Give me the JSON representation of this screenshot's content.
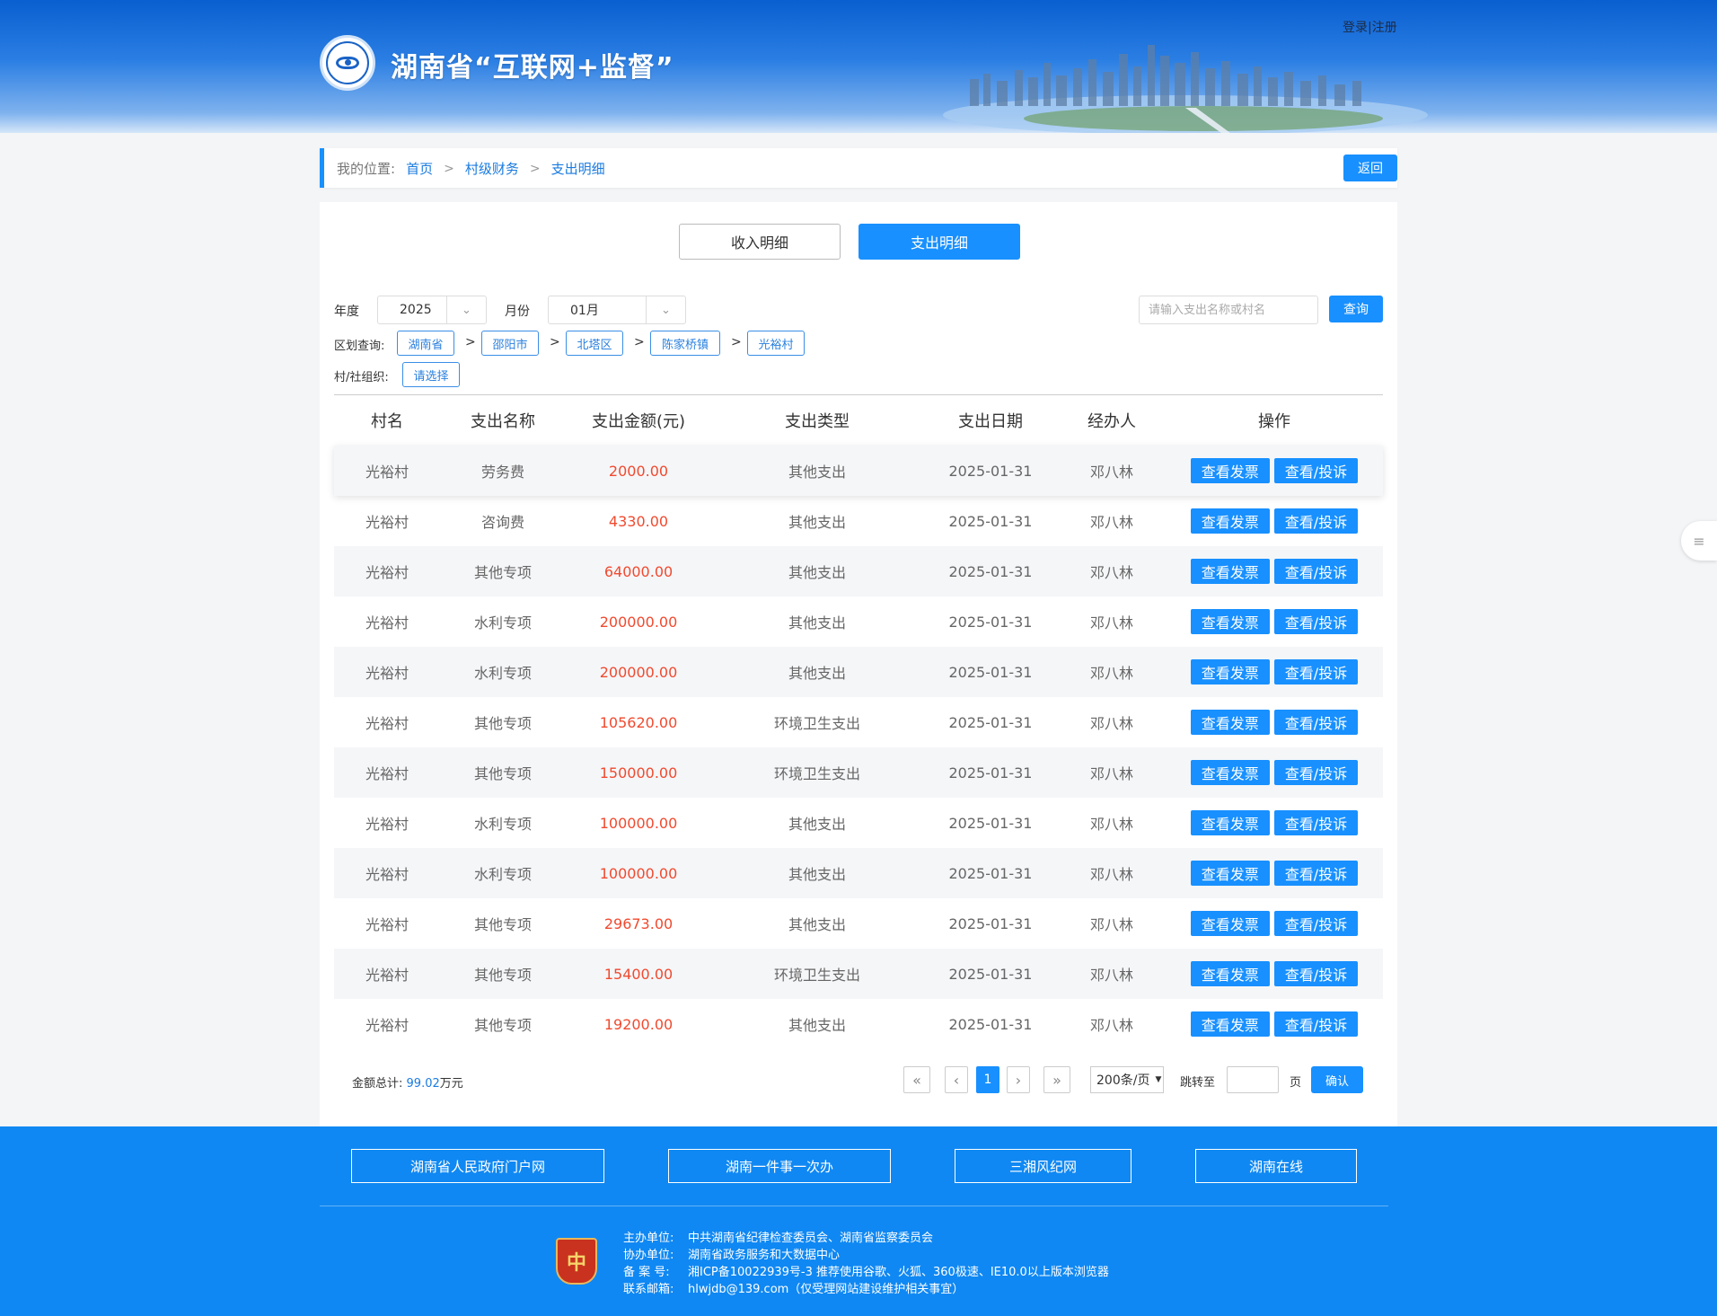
{
  "header": {
    "site_title": "湖南省“互联网+监督”",
    "login": "登录",
    "separator": "|",
    "register": "注册"
  },
  "breadcrumb": {
    "prefix": "我的位置:",
    "items": [
      "首页",
      "村级财务",
      "支出明细"
    ],
    "sep": ">",
    "back_label": "返回"
  },
  "tabs": {
    "income": "收入明细",
    "expense": "支出明细"
  },
  "filters": {
    "year_label": "年度",
    "year_value": "2025",
    "month_label": "月份",
    "month_value": "01月",
    "search_placeholder": "请输入支出名称或村名",
    "query_label": "查询",
    "region_label": "区划查询:",
    "regions": [
      "湖南省",
      "邵阳市",
      "北塔区",
      "陈家桥镇",
      "光裕村"
    ],
    "org_label": "村/社组织:",
    "org_value": "请选择"
  },
  "table": {
    "headers": [
      "村名",
      "支出名称",
      "支出金额(元)",
      "支出类型",
      "支出日期",
      "经办人",
      "操作"
    ],
    "action_invoice": "查看发票",
    "action_complain": "查看/投诉",
    "rows": [
      {
        "village": "光裕村",
        "name": "劳务费",
        "amount": "2000.00",
        "type": "其他支出",
        "date": "2025-01-31",
        "handler": "邓八林"
      },
      {
        "village": "光裕村",
        "name": "咨询费",
        "amount": "4330.00",
        "type": "其他支出",
        "date": "2025-01-31",
        "handler": "邓八林"
      },
      {
        "village": "光裕村",
        "name": "其他专项",
        "amount": "64000.00",
        "type": "其他支出",
        "date": "2025-01-31",
        "handler": "邓八林"
      },
      {
        "village": "光裕村",
        "name": "水利专项",
        "amount": "200000.00",
        "type": "其他支出",
        "date": "2025-01-31",
        "handler": "邓八林"
      },
      {
        "village": "光裕村",
        "name": "水利专项",
        "amount": "200000.00",
        "type": "其他支出",
        "date": "2025-01-31",
        "handler": "邓八林"
      },
      {
        "village": "光裕村",
        "name": "其他专项",
        "amount": "105620.00",
        "type": "环境卫生支出",
        "date": "2025-01-31",
        "handler": "邓八林"
      },
      {
        "village": "光裕村",
        "name": "其他专项",
        "amount": "150000.00",
        "type": "环境卫生支出",
        "date": "2025-01-31",
        "handler": "邓八林"
      },
      {
        "village": "光裕村",
        "name": "水利专项",
        "amount": "100000.00",
        "type": "其他支出",
        "date": "2025-01-31",
        "handler": "邓八林"
      },
      {
        "village": "光裕村",
        "name": "水利专项",
        "amount": "100000.00",
        "type": "其他支出",
        "date": "2025-01-31",
        "handler": "邓八林"
      },
      {
        "village": "光裕村",
        "name": "其他专项",
        "amount": "29673.00",
        "type": "其他支出",
        "date": "2025-01-31",
        "handler": "邓八林"
      },
      {
        "village": "光裕村",
        "name": "其他专项",
        "amount": "15400.00",
        "type": "环境卫生支出",
        "date": "2025-01-31",
        "handler": "邓八林"
      },
      {
        "village": "光裕村",
        "name": "其他专项",
        "amount": "19200.00",
        "type": "其他支出",
        "date": "2025-01-31",
        "handler": "邓八林"
      }
    ]
  },
  "summary": {
    "total_label": "金额总计:",
    "total_value": "99.02",
    "total_unit": "万元"
  },
  "pagination": {
    "first": "«",
    "prev": "‹",
    "current": "1",
    "next": "›",
    "last": "»",
    "page_size": "200条/页",
    "jump_label": "跳转至",
    "page_unit": "页",
    "confirm_label": "确认"
  },
  "footer": {
    "links": [
      "湖南省人民政府门户网",
      "湖南一件事一次办",
      "三湘风纪网",
      "湖南在线"
    ],
    "info": [
      {
        "label": "主办单位:",
        "value": "中共湖南省纪律检查委员会、湖南省监察委员会"
      },
      {
        "label": "协办单位:",
        "value": "湖南省政务服务和大数据中心"
      },
      {
        "label": "备 案 号:",
        "value": "湘ICP备10022939号-3   推荐使用谷歌、火狐、360极速、IE10.0以上版本浏览器"
      },
      {
        "label": "联系邮箱:",
        "value": "hlwjdb@139.com（仅受理网站建设维护相关事宜）"
      }
    ],
    "emblem_glyph": "中"
  },
  "colors": {
    "primary": "#1890ff",
    "amount": "#f04a2f",
    "footer_bg": "#0f88f3"
  }
}
